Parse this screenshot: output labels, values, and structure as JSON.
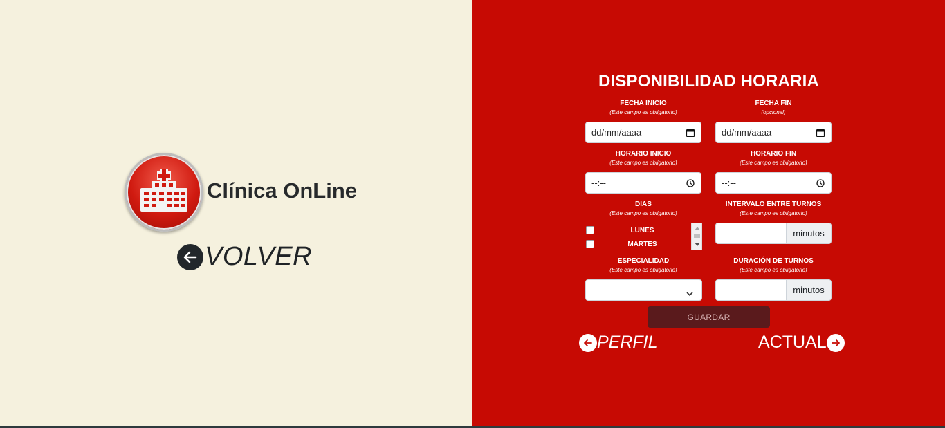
{
  "brand": {
    "name": "Clínica OnLine",
    "logo_icon": "hospital-building-icon"
  },
  "back_link": {
    "label": "VOLVER",
    "icon": "arrow-left-icon"
  },
  "form": {
    "title": "DISPONIBILIDAD HORARIA",
    "fecha_inicio": {
      "label": "FECHA INICIO",
      "hint": "(Este campo es obligatorio)",
      "placeholder": "dd/mm/aaaa",
      "icon": "calendar-icon"
    },
    "fecha_fin": {
      "label": "FECHA FIN",
      "hint": "(opcional)",
      "placeholder": "dd/mm/aaaa",
      "icon": "calendar-icon"
    },
    "horario_inicio": {
      "label": "HORARIO INICIO",
      "hint": "(Este campo es obligatorio)",
      "placeholder": "--:--",
      "icon": "clock-icon"
    },
    "horario_fin": {
      "label": "HORARIO FIN",
      "hint": "(Este campo es obligatorio)",
      "placeholder": "--:--",
      "icon": "clock-icon"
    },
    "dias": {
      "label": "DIAS",
      "hint": "(Este campo es obligatorio)",
      "options": [
        "LUNES",
        "MARTES"
      ]
    },
    "intervalo": {
      "label": "INTERVALO ENTRE TURNOS",
      "hint": "(Este campo es obligatorio)",
      "unit": "minutos",
      "value": ""
    },
    "especialidad": {
      "label": "ESPECIALIDAD",
      "hint": "(Este campo es obligatorio)",
      "value": ""
    },
    "duracion": {
      "label": "DURACIÓN DE TURNOS",
      "hint": "(Este campo es obligatorio)",
      "unit": "minutos",
      "value": ""
    },
    "save_label": "GUARDAR"
  },
  "nav": {
    "perfil": {
      "label": "PERFIL",
      "icon": "arrow-left-icon"
    },
    "actual": {
      "label": "ACTUAL",
      "icon": "arrow-right-icon"
    }
  },
  "colors": {
    "left_bg": "#f5f1de",
    "right_bg": "#c70a03",
    "button_bg": "#5a1a1c"
  }
}
